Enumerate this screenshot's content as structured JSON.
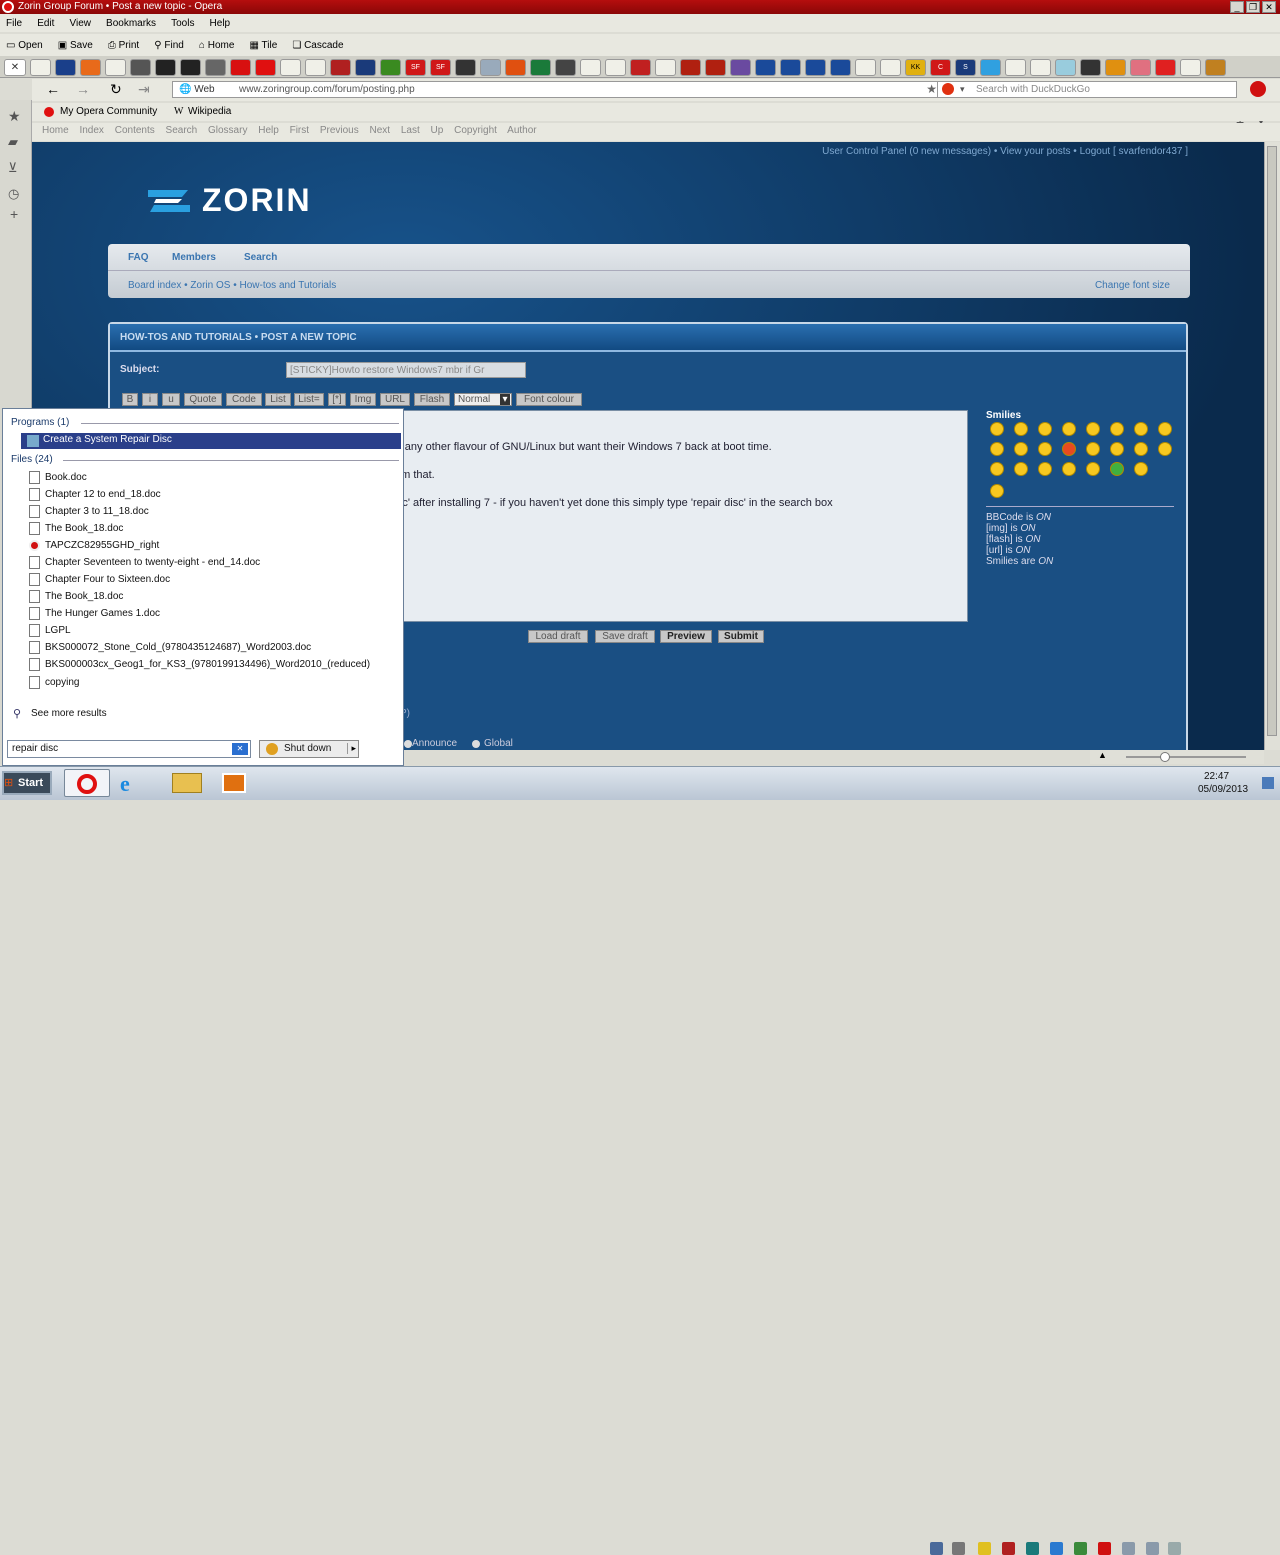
{
  "window": {
    "title": "Zorin Group Forum • Post a new topic - Opera"
  },
  "menu": [
    "File",
    "Edit",
    "View",
    "Bookmarks",
    "Tools",
    "Help"
  ],
  "toolbar": [
    "Open",
    "Save",
    "Print",
    "Find",
    "Home",
    "Tile",
    "Cascade"
  ],
  "address": {
    "web_label": "Web",
    "url": "www.zoringroup.com/forum/posting.php",
    "search_placeholder": "Search with DuckDuckGo"
  },
  "bookmarks": [
    "My Opera Community",
    "Wikipedia"
  ],
  "nav": [
    "Home",
    "Index",
    "Contents",
    "Search",
    "Glossary",
    "Help",
    "First",
    "Previous",
    "Next",
    "Last",
    "Up",
    "Copyright",
    "Author"
  ],
  "forum": {
    "user_links": "User Control Panel (0 new messages) • View your posts • Logout [ svarfendor437 ]",
    "logo": "ZORIN",
    "menu": [
      "FAQ",
      "Members",
      "Search"
    ],
    "breadcrumb": "Board index • Zorin OS • How-tos and Tutorials",
    "change_font": "Change font size",
    "section_title": "HOW-TOS AND TUTORIALS • POST A NEW TOPIC",
    "subject_label": "Subject:",
    "subject_value": "[STICKY]Howto restore Windows7 mbr if Gr",
    "bbcode_buttons": [
      "B",
      "i",
      "u",
      "Quote",
      "Code",
      "List",
      "List=",
      "[*]",
      "Img",
      "URL",
      "Flash"
    ],
    "font_size": "Normal",
    "font_colour": "Font colour",
    "body_lines": [
      "rin (or any other flavour of GNU/Linux but want their Windows 7 back at boot time.",
      "air from that.",
      "air disc' after installing 7 - if you haven't yet done this simply type 'repair disc' in the search box"
    ],
    "smilies_title": "Smilies",
    "status": [
      {
        "label": "BBCode is",
        "state": "ON"
      },
      {
        "label": "[img] is",
        "state": "ON"
      },
      {
        "label": "[flash] is",
        "state": "ON"
      },
      {
        "label": "[url] is",
        "state": "ON"
      },
      {
        "label": "Smilies are",
        "state": "ON"
      }
    ],
    "buttons": [
      "Load draft",
      "Save draft",
      "Preview",
      "Submit"
    ],
    "partial": "P)",
    "radio_announce": "Announce",
    "radio_global": "Global"
  },
  "start_menu": {
    "programs_header": "Programs (1)",
    "program": "Create a System Repair Disc",
    "files_header": "Files (24)",
    "files": [
      "Book.doc",
      "Chapter 12 to end_18.doc",
      "Chapter 3 to 11_18.doc",
      "The Book_18.doc",
      "TAPCZC82955GHD_right",
      "Chapter Seventeen to twenty-eight - end_14.doc",
      "Chapter Four to Sixteen.doc",
      "The Book_18.doc",
      "The Hunger Games 1.doc",
      "LGPL",
      "BKS000072_Stone_Cold_(9780435124687)_Word2003.doc",
      "BKS000003cx_Geog1_for_KS3_(9780199134496)_Word2010_(reduced)",
      "copying"
    ],
    "see_more": "See more results",
    "search_value": "repair disc",
    "shutdown": "Shut down"
  },
  "taskbar": {
    "start": "Start",
    "time": "22:47",
    "date": "05/09/2013"
  }
}
